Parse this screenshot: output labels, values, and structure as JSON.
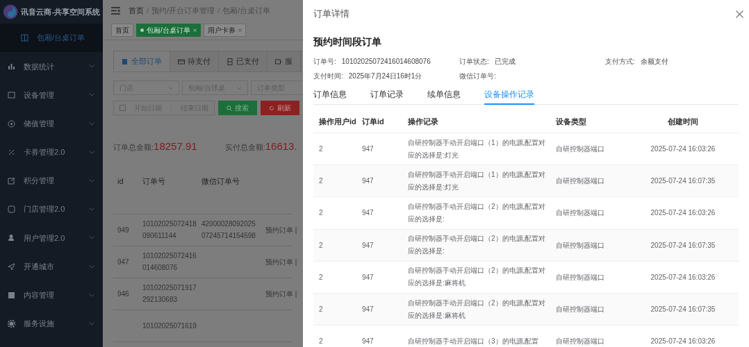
{
  "app": {
    "title": "讯音云商-共享空间系统"
  },
  "sidebar": {
    "items": [
      {
        "label": "包厢/台桌订单",
        "kind": "sub",
        "selected": true
      },
      {
        "label": "数据统计",
        "kind": "group",
        "selected": false
      },
      {
        "label": "设备管理",
        "kind": "group",
        "selected": false
      },
      {
        "label": "储值管理",
        "kind": "group",
        "selected": false
      },
      {
        "label": "卡券管理2.0",
        "kind": "group",
        "selected": false
      },
      {
        "label": "积分管理",
        "kind": "group",
        "selected": false
      },
      {
        "label": "门店管理2.0",
        "kind": "group",
        "selected": false
      },
      {
        "label": "用户管理2.0",
        "kind": "group",
        "selected": false
      },
      {
        "label": "开通城市",
        "kind": "group",
        "selected": false
      },
      {
        "label": "内容管理",
        "kind": "group",
        "selected": false
      },
      {
        "label": "服务设施",
        "kind": "group",
        "selected": false
      }
    ]
  },
  "breadcrumb": {
    "separator": "/",
    "items": [
      "首页",
      "预约/开台订单管理",
      "包厢/台桌订单"
    ]
  },
  "page_tags": [
    {
      "label": "首页",
      "selected": false,
      "closable": false
    },
    {
      "label": "包厢/台桌订单",
      "selected": true,
      "closable": true
    },
    {
      "label": "用户卡券",
      "selected": false,
      "closable": true
    }
  ],
  "order_tabs": [
    {
      "label": "全部订单",
      "selected": true
    },
    {
      "label": "待支付",
      "selected": false
    },
    {
      "label": "已支付",
      "selected": false
    },
    {
      "label": "服",
      "selected": false
    }
  ],
  "filters": {
    "selects": [
      "门店",
      "包厢/台球桌",
      "订单类型"
    ],
    "date_start": "开始日期",
    "date_sep": ":",
    "date_end": "结束日期",
    "search": "搜索",
    "refresh": "刷新"
  },
  "totals": [
    {
      "label": "订单总金额:",
      "value": "18257.91"
    },
    {
      "label": "实付总金额:",
      "value": "16613."
    }
  ],
  "orders_table": {
    "columns": [
      "id",
      "订单号",
      "微信订单号"
    ],
    "rows": [
      {
        "id": "949",
        "order_no": [
          "10102025072418",
          "090611144"
        ],
        "wx_no": [
          "42000028092025",
          "07245714154598"
        ],
        "type": "预约订单 | "
      },
      {
        "id": "947",
        "order_no": [
          "10102025072416",
          "014608076"
        ],
        "wx_no": [],
        "type": "预约订单 | "
      },
      {
        "id": "946",
        "order_no": [
          "10102025071917",
          "292130683"
        ],
        "wx_no": [],
        "type": "预约订单 | "
      },
      {
        "order_no": [
          "10102025071619"
        ],
        "wx_no": []
      }
    ]
  },
  "drawer": {
    "title": "订单详情",
    "heading": "预约时间段订单",
    "fields": [
      {
        "label": "订单号:",
        "value": "10102025072416014608076"
      },
      {
        "label": "订单状态:",
        "value": "已完成"
      },
      {
        "label": "支付方式:",
        "value": "余额支付"
      },
      {
        "label": "支付时间:",
        "value": "2025年7月24日16时1分"
      },
      {
        "label": "微信订单号:"
      }
    ],
    "tabs": [
      {
        "label": "订单信息",
        "selected": false
      },
      {
        "label": "订单记录",
        "selected": false
      },
      {
        "label": "续单信息",
        "selected": false
      },
      {
        "label": "设备操作记录",
        "selected": true
      }
    ],
    "table": {
      "columns": [
        "操作用户id",
        "订单id",
        "操作记录",
        "设备类型",
        "创建时间"
      ],
      "rows": [
        [
          "2",
          "947",
          "自研控制器手动开启端口（1）的电源,配置对应的选择是:灯光",
          "自研控制器端口",
          "2025-07-24 16:03:26"
        ],
        [
          "2",
          "947",
          "自研控制器手动开启端口（1）的电源,配置对应的选择是:灯光",
          "自研控制器端口",
          "2025-07-24 16:07:35"
        ],
        [
          "2",
          "947",
          "自研控制器手动开启端口（2）的电源,配置对应的选择是:",
          "自研控制器端口",
          "2025-07-24 16:03:26"
        ],
        [
          "2",
          "947",
          "自研控制器手动开启端口（2）的电源,配置对应的选择是:",
          "自研控制器端口",
          "2025-07-24 16:07:35"
        ],
        [
          "2",
          "947",
          "自研控制器手动开启端口（2）的电源,配置对应的选择是:麻将机",
          "自研控制器端口",
          "2025-07-24 16:03:26"
        ],
        [
          "2",
          "947",
          "自研控制器手动开启端口（2）的电源,配置对应的选择是:麻将机",
          "自研控制器端口",
          "2025-07-24 16:07:35"
        ],
        [
          "2",
          "947",
          "自研控制器手动开启端口（3）的电源,配置",
          "自研控制器端口",
          "2025-07-24 16:03:26"
        ]
      ]
    }
  }
}
